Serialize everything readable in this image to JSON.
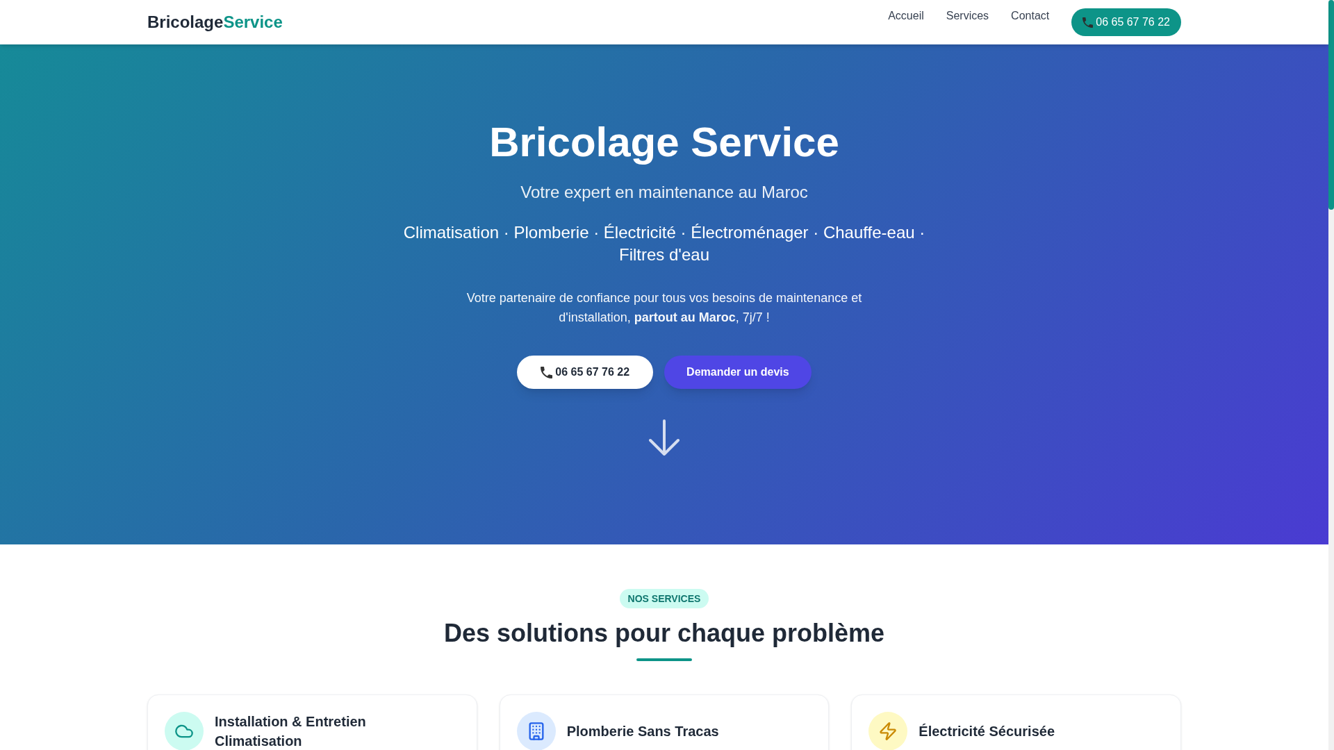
{
  "nav": {
    "logo": {
      "primary": "Bricolage",
      "accent": "Service"
    },
    "links": [
      "Accueil",
      "Services",
      "Contact"
    ],
    "phone_button": "06 65 67 76 22"
  },
  "hero": {
    "title": "Bricolage Service",
    "subtitle": "Votre expert en maintenance au Maroc",
    "services_line": "Climatisation · Plomberie · Électricité · Électroménager · Chauffe-eau · Filtres d'eau",
    "description": "Votre partenaire de confiance pour tous vos besoins de maintenance et d'installation, **partout au Maroc**, 7j/7 !",
    "buttons": [
      {
        "kind": "phone",
        "label": "06 65 67 76 22"
      },
      {
        "kind": "quote",
        "label": "Demander un devis"
      }
    ]
  },
  "services_section": {
    "badge": "NOS SERVICES",
    "heading": "Des solutions pour chaque problème",
    "cards": [
      {
        "kind": "cloud",
        "title": "Installation & Entretien Climatisation"
      },
      {
        "kind": "building",
        "title": "Plomberie Sans Tracas"
      },
      {
        "kind": "bolt",
        "title": "Électricité Sécurisée"
      }
    ]
  }
}
